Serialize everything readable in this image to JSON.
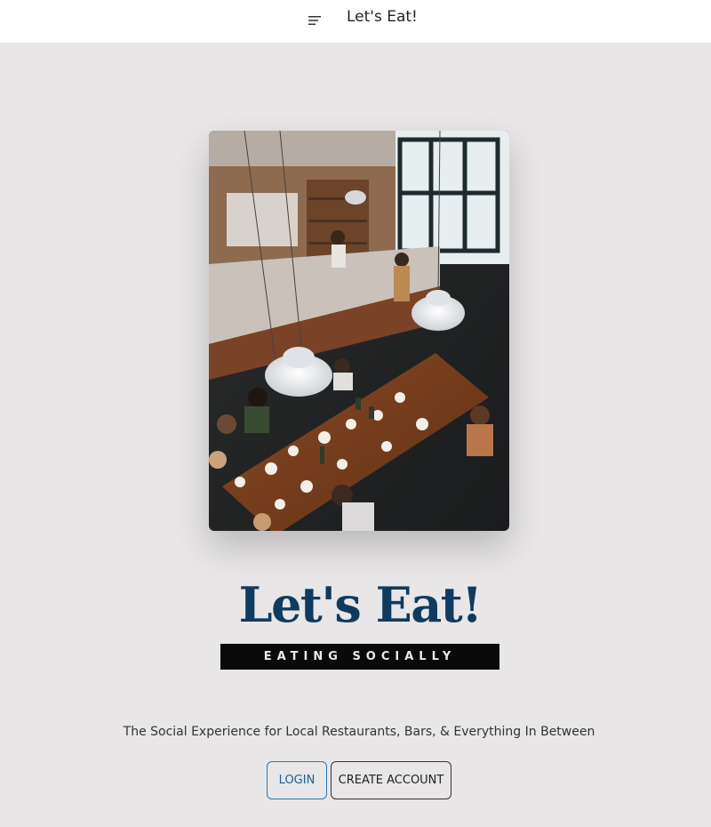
{
  "header": {
    "menu_icon": "hamburger-menu-icon",
    "title": "Let's Eat!"
  },
  "hero": {
    "image_alt": "Overhead view of a busy restaurant with a long wooden communal table"
  },
  "logo": {
    "title": "Let's Eat!",
    "tagline": "EATING SOCIALLY"
  },
  "main": {
    "subtitle": "The Social Experience for Local Restaurants, Bars, & Everything In Between"
  },
  "actions": {
    "login_label": "LOGIN",
    "create_label": "CREATE ACCOUNT"
  },
  "colors": {
    "page_background": "#e8e6e7",
    "brand_navy": "#0f3b5f",
    "login_accent": "#2a78b3"
  }
}
